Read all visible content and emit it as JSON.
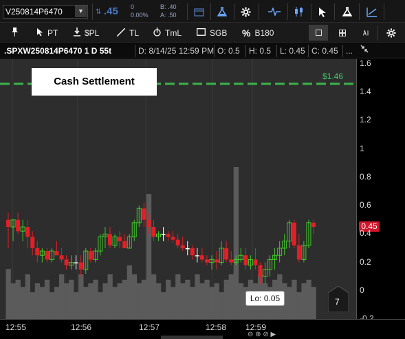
{
  "toolbar": {
    "symbol": "V250814P6470",
    "last_price": ".45",
    "change": "0",
    "change_pct": "0.00%",
    "bid": "B: .40",
    "ask": "A: .50"
  },
  "drawing_tools": {
    "pt": "PT",
    "spl": "$PL",
    "tl": "TL",
    "tml": "TmL",
    "sgb": "SGB",
    "b180": "B180"
  },
  "info_bar": {
    "symbol": ".SPXW250814P6470 1 D 55t",
    "date": "D: 8/14/25 12:59 PM",
    "open": "O: 0.5",
    "high": "H: 0.5",
    "low": "L: 0.45",
    "close": "C: 0.45",
    "more": "..."
  },
  "chart_labels": {
    "cash_settlement": "Cash Settlement",
    "settlement_price": "$1.46",
    "current_price": "0.45",
    "low_label": "Lo: 0.05",
    "count": "7"
  },
  "colors": {
    "up": "#43c72a",
    "down": "#e21f26",
    "settlement_line": "#3cb44a",
    "volume": "#5b5b5b",
    "accent": "#4a78c8"
  },
  "icons": {
    "flask": "flask-icon",
    "gear": "gear-icon",
    "cursor": "cursor-icon"
  },
  "chart_data": {
    "type": "candlestick",
    "y_axis": {
      "ticks": [
        "1.6",
        "1.4",
        "1.2",
        "1",
        "0.8",
        "0.6",
        "0.4",
        "0.2",
        "0",
        "-0.2"
      ],
      "ylim": [
        -0.2,
        1.65
      ]
    },
    "x_axis": {
      "ticks": [
        "12:55",
        "12:56",
        "12:57",
        "12:58",
        "12:59"
      ]
    },
    "settlement": 1.46,
    "last": 0.45,
    "low": 0.05,
    "candles": [
      {
        "o": 0.5,
        "h": 0.55,
        "l": 0.3,
        "c": 0.45
      },
      {
        "o": 0.45,
        "h": 0.5,
        "l": 0.35,
        "c": 0.5
      },
      {
        "o": 0.5,
        "h": 0.55,
        "l": 0.4,
        "c": 0.42
      },
      {
        "o": 0.42,
        "h": 0.5,
        "l": 0.35,
        "c": 0.45
      },
      {
        "o": 0.45,
        "h": 0.5,
        "l": 0.3,
        "c": 0.38
      },
      {
        "o": 0.38,
        "h": 0.42,
        "l": 0.25,
        "c": 0.3
      },
      {
        "o": 0.3,
        "h": 0.35,
        "l": 0.2,
        "c": 0.25
      },
      {
        "o": 0.25,
        "h": 0.3,
        "l": 0.2,
        "c": 0.28
      },
      {
        "o": 0.28,
        "h": 0.3,
        "l": 0.2,
        "c": 0.22
      },
      {
        "o": 0.22,
        "h": 0.3,
        "l": 0.2,
        "c": 0.28
      },
      {
        "o": 0.28,
        "h": 0.35,
        "l": 0.25,
        "c": 0.25
      },
      {
        "o": 0.25,
        "h": 0.3,
        "l": 0.2,
        "c": 0.22
      },
      {
        "o": 0.22,
        "h": 0.25,
        "l": 0.15,
        "c": 0.18
      },
      {
        "o": 0.18,
        "h": 0.25,
        "l": 0.15,
        "c": 0.2
      },
      {
        "o": 0.2,
        "h": 0.25,
        "l": 0.15,
        "c": 0.2
      },
      {
        "o": 0.2,
        "h": 0.25,
        "l": 0.1,
        "c": 0.15
      },
      {
        "o": 0.15,
        "h": 0.3,
        "l": 0.12,
        "c": 0.28
      },
      {
        "o": 0.28,
        "h": 0.3,
        "l": 0.2,
        "c": 0.22
      },
      {
        "o": 0.22,
        "h": 0.3,
        "l": 0.2,
        "c": 0.28
      },
      {
        "o": 0.28,
        "h": 0.4,
        "l": 0.25,
        "c": 0.38
      },
      {
        "o": 0.38,
        "h": 0.45,
        "l": 0.3,
        "c": 0.4
      },
      {
        "o": 0.4,
        "h": 0.45,
        "l": 0.3,
        "c": 0.32
      },
      {
        "o": 0.32,
        "h": 0.4,
        "l": 0.3,
        "c": 0.38
      },
      {
        "o": 0.38,
        "h": 0.42,
        "l": 0.3,
        "c": 0.35
      },
      {
        "o": 0.35,
        "h": 0.4,
        "l": 0.3,
        "c": 0.3
      },
      {
        "o": 0.3,
        "h": 0.4,
        "l": 0.3,
        "c": 0.38
      },
      {
        "o": 0.38,
        "h": 0.5,
        "l": 0.35,
        "c": 0.48
      },
      {
        "o": 0.48,
        "h": 0.6,
        "l": 0.45,
        "c": 0.58
      },
      {
        "o": 0.58,
        "h": 0.62,
        "l": 0.45,
        "c": 0.5
      },
      {
        "o": 0.5,
        "h": 0.55,
        "l": 0.4,
        "c": 0.45
      },
      {
        "o": 0.45,
        "h": 0.5,
        "l": 0.35,
        "c": 0.38
      },
      {
        "o": 0.38,
        "h": 0.42,
        "l": 0.35,
        "c": 0.4
      },
      {
        "o": 0.4,
        "h": 0.45,
        "l": 0.35,
        "c": 0.4
      },
      {
        "o": 0.4,
        "h": 0.42,
        "l": 0.35,
        "c": 0.38
      },
      {
        "o": 0.38,
        "h": 0.42,
        "l": 0.34,
        "c": 0.36
      },
      {
        "o": 0.36,
        "h": 0.4,
        "l": 0.3,
        "c": 0.32
      },
      {
        "o": 0.32,
        "h": 0.38,
        "l": 0.28,
        "c": 0.3
      },
      {
        "o": 0.3,
        "h": 0.35,
        "l": 0.25,
        "c": 0.3
      },
      {
        "o": 0.3,
        "h": 0.32,
        "l": 0.22,
        "c": 0.25
      },
      {
        "o": 0.25,
        "h": 0.3,
        "l": 0.2,
        "c": 0.25
      },
      {
        "o": 0.25,
        "h": 0.3,
        "l": 0.2,
        "c": 0.22
      },
      {
        "o": 0.22,
        "h": 0.25,
        "l": 0.18,
        "c": 0.2
      },
      {
        "o": 0.2,
        "h": 0.25,
        "l": 0.15,
        "c": 0.22
      },
      {
        "o": 0.22,
        "h": 0.28,
        "l": 0.15,
        "c": 0.2
      },
      {
        "o": 0.2,
        "h": 0.35,
        "l": 0.18,
        "c": 0.3
      },
      {
        "o": 0.3,
        "h": 0.35,
        "l": 0.2,
        "c": 0.22
      },
      {
        "o": 0.22,
        "h": 0.28,
        "l": 0.18,
        "c": 0.2
      },
      {
        "o": 0.2,
        "h": 0.25,
        "l": 0.18,
        "c": 0.22
      },
      {
        "o": 0.22,
        "h": 0.3,
        "l": 0.2,
        "c": 0.25
      },
      {
        "o": 0.25,
        "h": 0.3,
        "l": 0.15,
        "c": 0.18
      },
      {
        "o": 0.18,
        "h": 0.25,
        "l": 0.15,
        "c": 0.22
      },
      {
        "o": 0.22,
        "h": 0.3,
        "l": 0.15,
        "c": 0.18
      },
      {
        "o": 0.18,
        "h": 0.2,
        "l": 0.05,
        "c": 0.1
      },
      {
        "o": 0.1,
        "h": 0.2,
        "l": 0.05,
        "c": 0.15
      },
      {
        "o": 0.15,
        "h": 0.25,
        "l": 0.1,
        "c": 0.22
      },
      {
        "o": 0.22,
        "h": 0.3,
        "l": 0.15,
        "c": 0.25
      },
      {
        "o": 0.25,
        "h": 0.35,
        "l": 0.2,
        "c": 0.3
      },
      {
        "o": 0.3,
        "h": 0.4,
        "l": 0.25,
        "c": 0.35
      },
      {
        "o": 0.35,
        "h": 0.5,
        "l": 0.3,
        "c": 0.48
      },
      {
        "o": 0.48,
        "h": 0.5,
        "l": 0.3,
        "c": 0.32
      },
      {
        "o": 0.32,
        "h": 0.4,
        "l": 0.2,
        "c": 0.22
      },
      {
        "o": 0.22,
        "h": 0.35,
        "l": 0.2,
        "c": 0.32
      },
      {
        "o": 0.32,
        "h": 0.5,
        "l": 0.3,
        "c": 0.48
      },
      {
        "o": 0.48,
        "h": 0.5,
        "l": 0.4,
        "c": 0.45
      }
    ],
    "volume": [
      0.28,
      0.2,
      0.22,
      0.18,
      0.25,
      0.15,
      0.2,
      0.18,
      0.22,
      0.15,
      0.18,
      0.25,
      0.2,
      0.22,
      0.15,
      0.25,
      0.18,
      0.2,
      0.22,
      0.15,
      0.2,
      0.25,
      0.18,
      0.2,
      0.22,
      0.3,
      0.25,
      0.2,
      0.22,
      0.7,
      0.25,
      0.2,
      0.15,
      0.22,
      0.18,
      0.25,
      0.2,
      0.22,
      0.18,
      0.25,
      0.2,
      0.22,
      0.18,
      0.2,
      0.15,
      0.22,
      0.25,
      0.85,
      0.2,
      0.18,
      0.22,
      0.2,
      0.25,
      0.2,
      0.18,
      0.22,
      0.25,
      0.2,
      0.18,
      0.22,
      0.15,
      0.2,
      0.22,
      0.18
    ]
  }
}
